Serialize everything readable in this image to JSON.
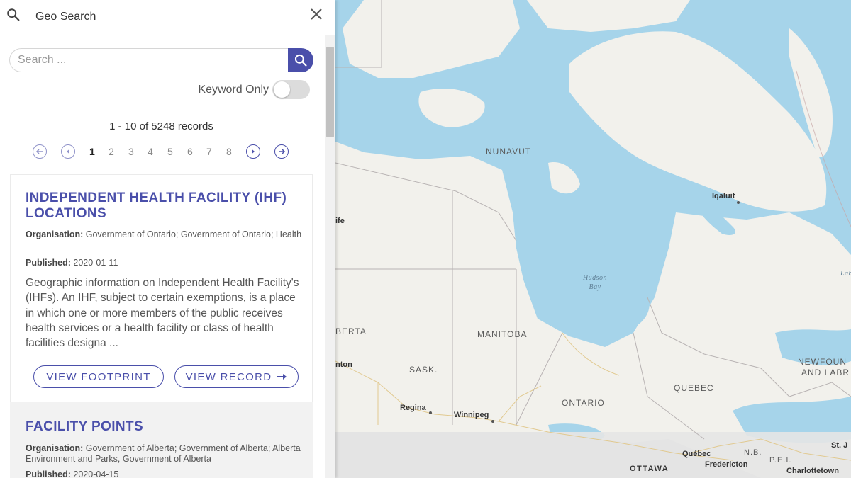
{
  "header": {
    "title": "Geo Search",
    "search_icon": "search-icon",
    "close_icon": "close-icon"
  },
  "search": {
    "placeholder": "Search ...",
    "value": "",
    "button_icon": "search-icon"
  },
  "keyword_toggle": {
    "label": "Keyword Only",
    "enabled": false
  },
  "results": {
    "count_text": "1 - 10 of 5248 records"
  },
  "pagination": {
    "pages": [
      "1",
      "2",
      "3",
      "4",
      "5",
      "6",
      "7",
      "8"
    ],
    "current": "1",
    "icons": [
      "first-page-icon",
      "previous-page-icon",
      "next-page-icon",
      "last-page-icon"
    ]
  },
  "records": [
    {
      "title": "INDEPENDENT HEALTH FACILITY (IHF) LOCATIONS",
      "organisation_label": "Organisation:",
      "organisation": "Government of Ontario; Government of Ontario; Health",
      "published_label": "Published:",
      "published": "2020-01-11",
      "description": "Geographic information on Independent Health Facility's (IHFs). An IHF, subject to certain exemptions, is a place in which one or more members of the public receives health services or a health facility or class of health facilities designa ...",
      "footprint_label": "VIEW FOOTPRINT",
      "record_label": "VIEW RECORD"
    },
    {
      "title": "FACILITY POINTS",
      "organisation_label": "Organisation:",
      "organisation": "Government of Alberta; Government of Alberta; Alberta Environment and Parks, Government of Alberta",
      "published_label": "Published:",
      "published": "2020-04-15"
    }
  ],
  "map": {
    "labels": {
      "nunavut": "NUNAVUT",
      "iqaluit": "Iqaluit",
      "hudson": "Hudson",
      "bay": "Bay",
      "manitoba": "MANITOBA",
      "sask": "SASK.",
      "berta": "BERTA",
      "nton": "nton",
      "ife": "ife",
      "regina": "Regina",
      "winnipeg": "Winnipeg",
      "ontario": "ONTARIO",
      "quebec_province": "QUEBEC",
      "newfound_1": "NEWFOUN",
      "newfound_2": "AND LABR",
      "lab": "Lab",
      "st_j": "St. J",
      "quebec_city": "Québec",
      "nb": "N.B.",
      "pei": "P.E.I.",
      "fredericton": "Fredericton",
      "charlottetown": "Charlottetown",
      "ottawa": "OTTAWA"
    },
    "colors": {
      "water": "#a6d4ea",
      "land": "#f2f1ec",
      "accent": "#4a4faa"
    }
  }
}
